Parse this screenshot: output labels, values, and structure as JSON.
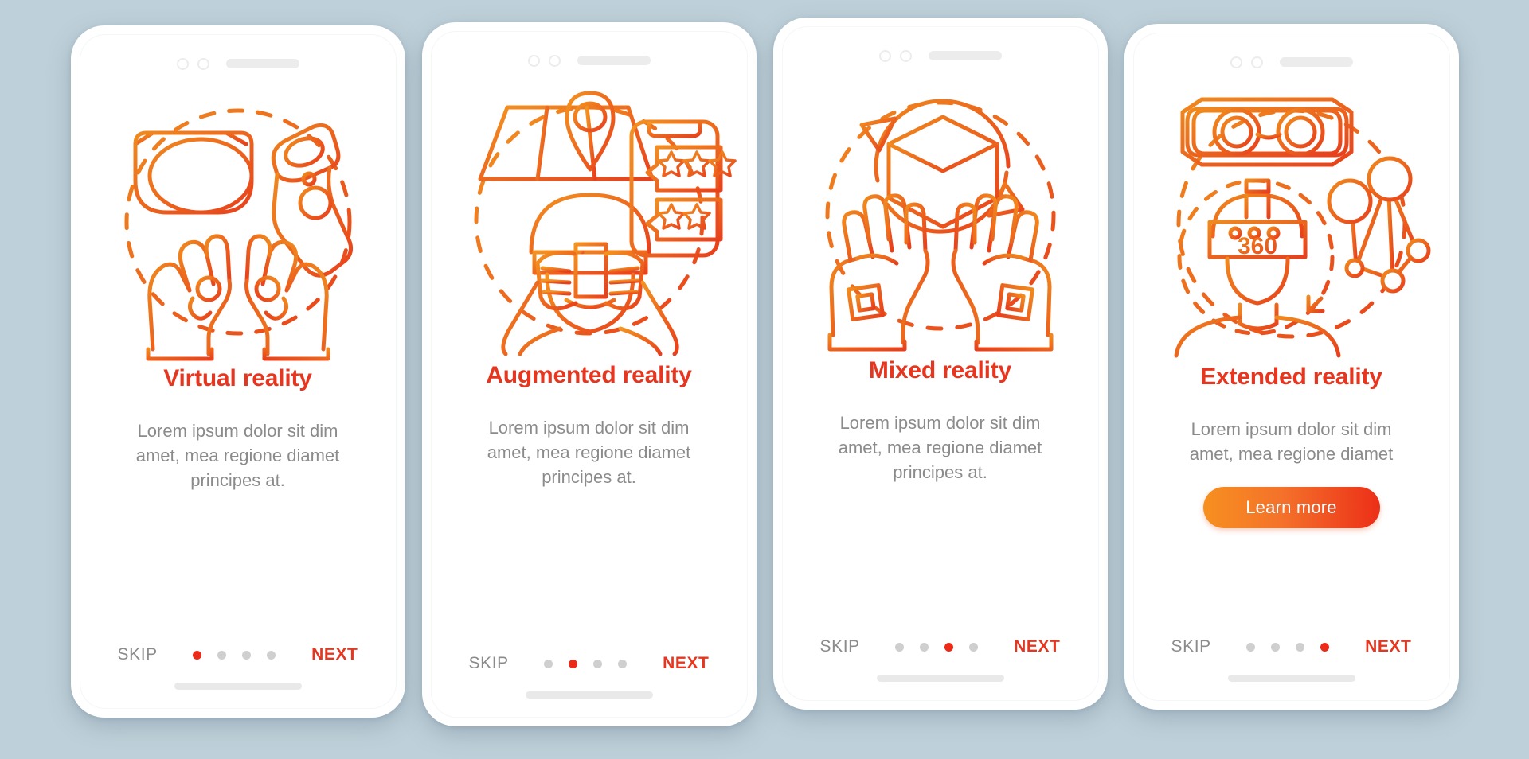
{
  "page": {
    "background_color": "#bed0d9",
    "accent_red": "#e63620",
    "accent_orange": "#f79020",
    "muted_gray": "#8b8b8b"
  },
  "common": {
    "skip_label": "SKIP",
    "next_label": "NEXT",
    "dot_count": 4
  },
  "screens": [
    {
      "title": "Virtual reality",
      "body": "Lorem ipsum dolor sit dim amet, mea regione diamet principes at.",
      "active_dot": 1,
      "skip_label": "SKIP",
      "next_label": "NEXT",
      "illustration": "vr-headset-controller-hands-icon",
      "cta": null
    },
    {
      "title": "Augmented reality",
      "body": "Lorem ipsum dolor sit dim amet, mea regione diamet principes at.",
      "active_dot": 2,
      "skip_label": "SKIP",
      "next_label": "NEXT",
      "illustration": "map-pin-person-phone-reviews-icon",
      "cta": null
    },
    {
      "title": "Mixed reality",
      "body": "Lorem ipsum dolor sit dim amet, mea regione diamet principes at.",
      "active_dot": 3,
      "skip_label": "SKIP",
      "next_label": "NEXT",
      "illustration": "rotating-cube-vr-gloves-icon",
      "cta": null
    },
    {
      "title": "Extended reality",
      "body": "Lorem ipsum dolor sit dim amet, mea regione diamet",
      "active_dot": 4,
      "skip_label": "SKIP",
      "next_label": "NEXT",
      "illustration": "vr-goggles-360-headset-network-icon",
      "cta": "Learn more"
    }
  ]
}
